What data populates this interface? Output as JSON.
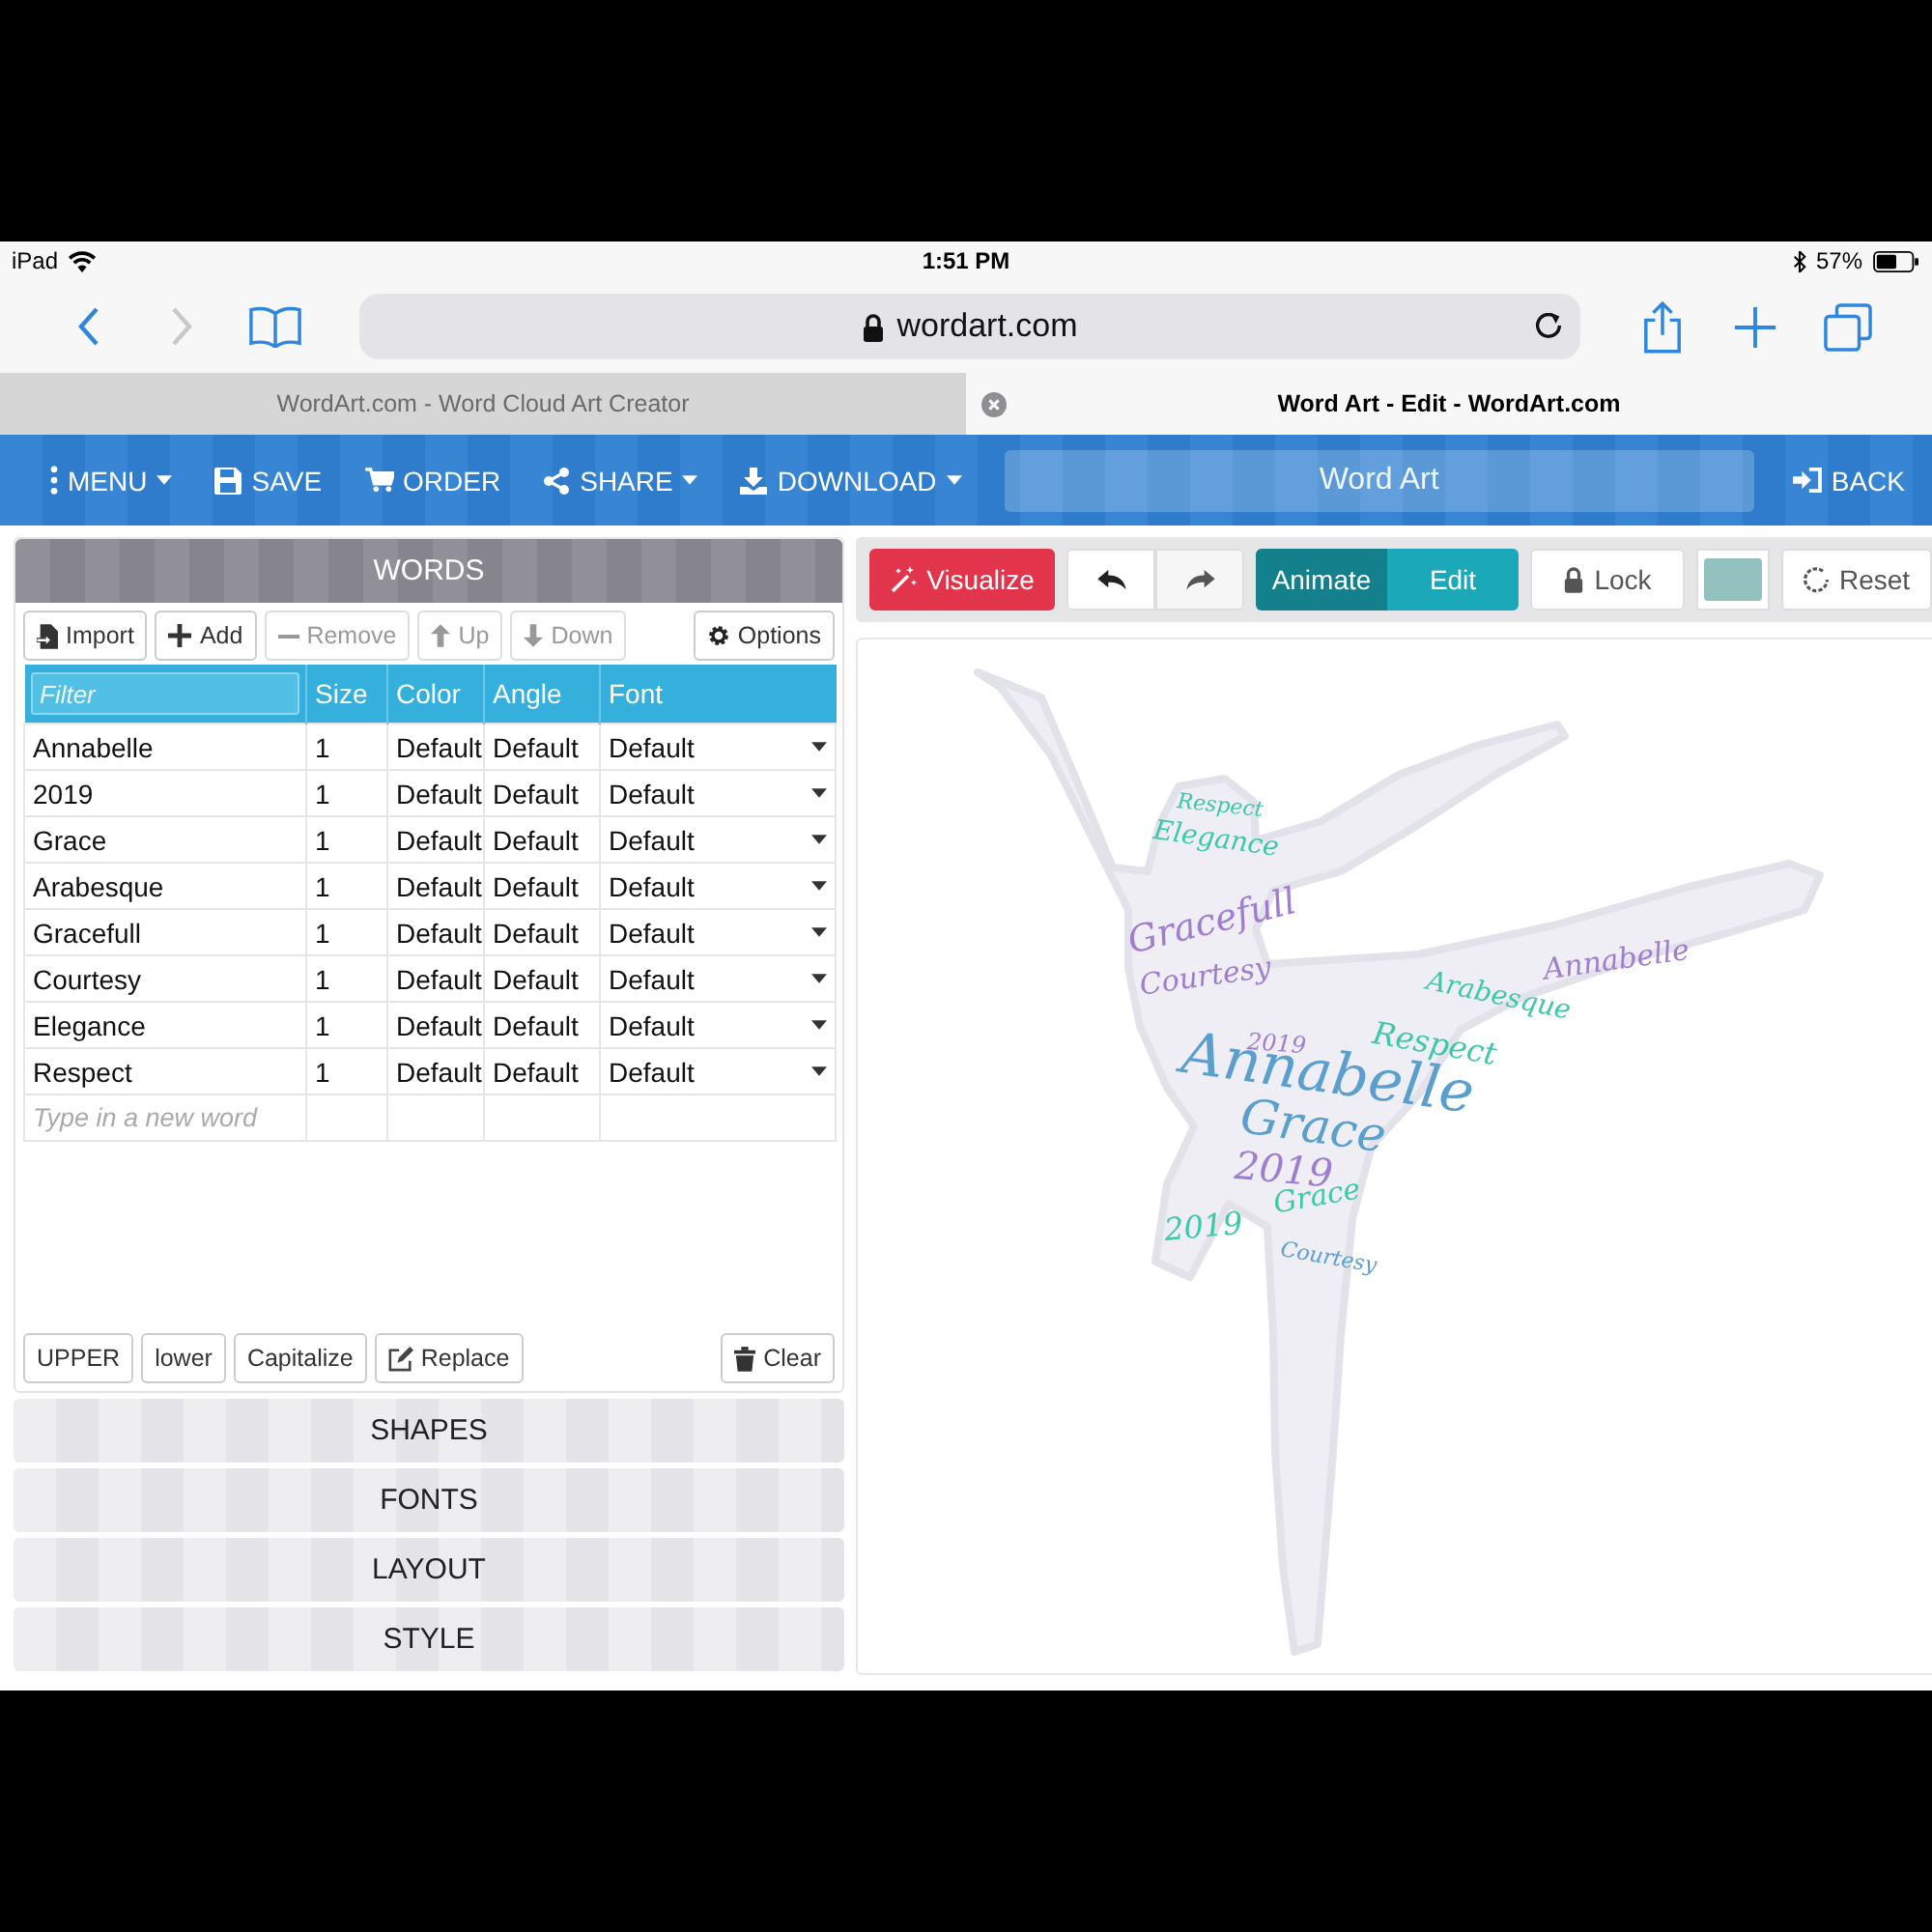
{
  "status_bar": {
    "device": "iPad",
    "time": "1:51 PM",
    "battery": "57%"
  },
  "browser": {
    "url": "wordart.com"
  },
  "tabs": [
    {
      "title": "WordArt.com - Word Cloud Art Creator",
      "selected": false
    },
    {
      "title": "Word Art - Edit - WordArt.com",
      "selected": true
    }
  ],
  "app_toolbar": {
    "items": [
      {
        "label": "MENU",
        "dropdown": true
      },
      {
        "label": "SAVE",
        "dropdown": false
      },
      {
        "label": "ORDER",
        "dropdown": false
      },
      {
        "label": "SHARE",
        "dropdown": true
      },
      {
        "label": "DOWNLOAD",
        "dropdown": true
      }
    ],
    "title": "Word Art",
    "back": "BACK"
  },
  "words_panel": {
    "title": "WORDS",
    "actions": [
      {
        "label": "Import",
        "disabled": false
      },
      {
        "label": "Add",
        "disabled": false
      },
      {
        "label": "Remove",
        "disabled": true
      },
      {
        "label": "Up",
        "disabled": true
      },
      {
        "label": "Down",
        "disabled": true
      }
    ],
    "options": "Options",
    "table": {
      "filter_placeholder": "Filter",
      "columns": [
        "Size",
        "Color",
        "Angle",
        "Font"
      ],
      "rows": [
        {
          "word": "Annabelle",
          "size": "1",
          "color_setting": "Default",
          "angle": "Default",
          "font": "Default"
        },
        {
          "word": "2019",
          "size": "1",
          "color_setting": "Default",
          "angle": "Default",
          "font": "Default"
        },
        {
          "word": "Grace",
          "size": "1",
          "color_setting": "Default",
          "angle": "Default",
          "font": "Default"
        },
        {
          "word": "Arabesque",
          "size": "1",
          "color_setting": "Default",
          "angle": "Default",
          "font": "Default"
        },
        {
          "word": "Gracefull",
          "size": "1",
          "color_setting": "Default",
          "angle": "Default",
          "font": "Default"
        },
        {
          "word": "Courtesy",
          "size": "1",
          "color_setting": "Default",
          "angle": "Default",
          "font": "Default"
        },
        {
          "word": "Elegance",
          "size": "1",
          "color_setting": "Default",
          "angle": "Default",
          "font": "Default"
        },
        {
          "word": "Respect",
          "size": "1",
          "color_setting": "Default",
          "angle": "Default",
          "font": "Default"
        }
      ],
      "new_word_placeholder": "Type in a new word"
    },
    "case_buttons": [
      "UPPER",
      "lower",
      "Capitalize",
      "Replace"
    ],
    "clear": "Clear"
  },
  "sections": [
    "SHAPES",
    "FONTS",
    "LAYOUT",
    "STYLE"
  ],
  "editor": {
    "visualize": "Visualize",
    "modes": [
      {
        "label": "Animate",
        "selected": true
      },
      {
        "label": "Edit",
        "selected": false
      }
    ],
    "lock": "Lock",
    "reset": "Reset",
    "cloud_words": [
      {
        "text": "Annabelle",
        "color": "#5b9fcf"
      },
      {
        "text": "Grace",
        "color": "#5b9fcf"
      },
      {
        "text": "2019",
        "color": "#a07dd0"
      },
      {
        "text": "Gracefull",
        "color": "#a07dd0"
      },
      {
        "text": "Courtesy",
        "color": "#a07dd0"
      },
      {
        "text": "Respect",
        "color": "#3fc7aa"
      },
      {
        "text": "Arabesque",
        "color": "#3fc7aa"
      },
      {
        "text": "Annabelle",
        "color": "#a07dd0"
      },
      {
        "text": "Elegance",
        "color": "#3fc7aa"
      },
      {
        "text": "Respect",
        "color": "#3fc7aa"
      },
      {
        "text": "2019",
        "color": "#3fc7aa"
      },
      {
        "text": "Grace",
        "color": "#3fc7aa"
      },
      {
        "text": "Courtesy",
        "color": "#5b9fcf"
      },
      {
        "text": "2019",
        "color": "#a07dd0"
      }
    ]
  }
}
